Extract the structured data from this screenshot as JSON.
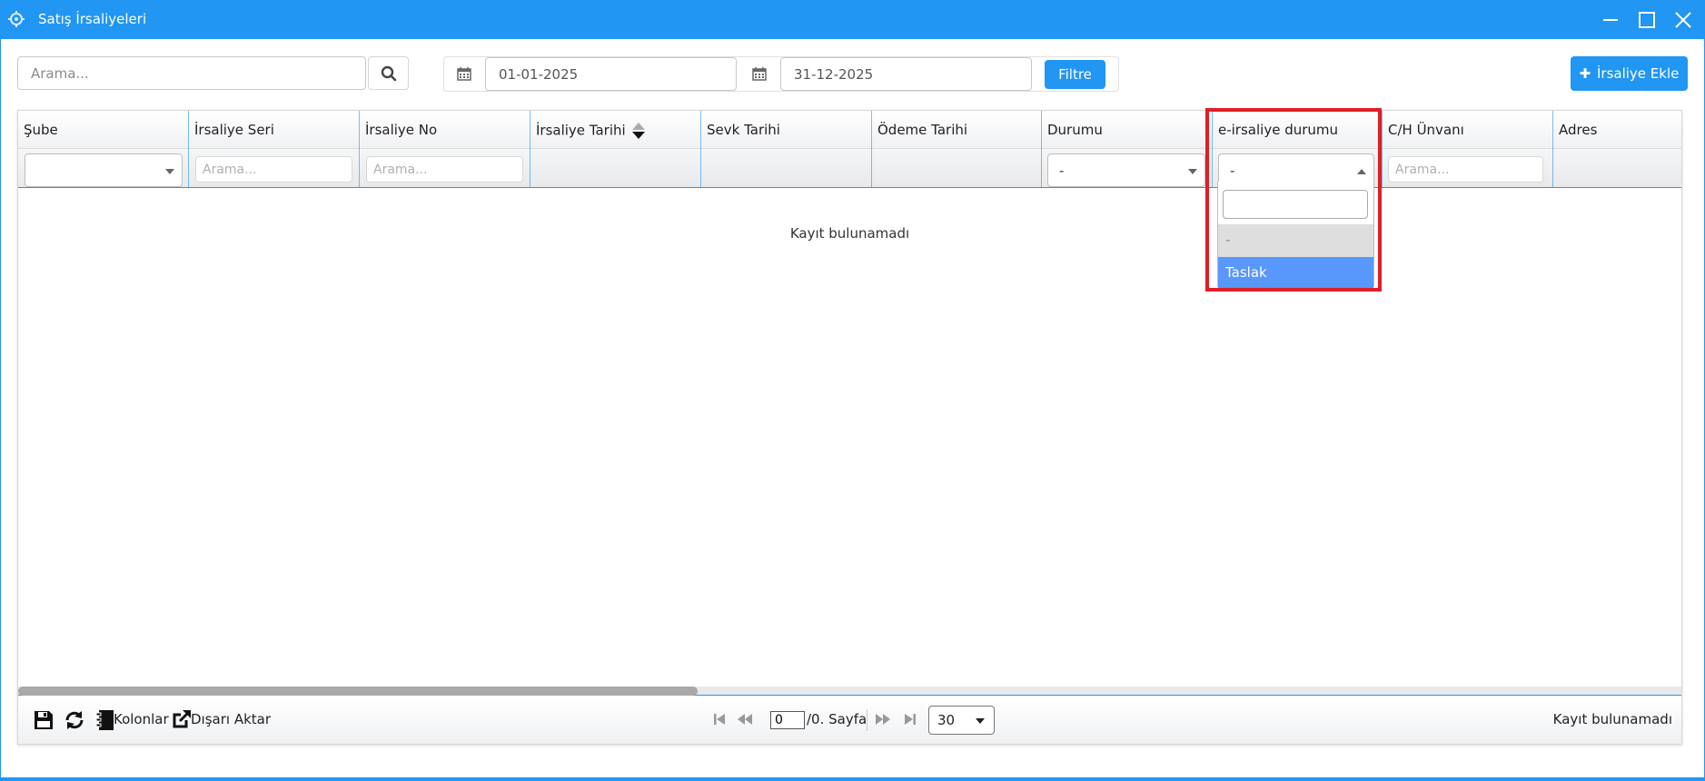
{
  "window": {
    "title": "Satış İrsaliyeleri",
    "title_icon": "gear-icon",
    "controls": [
      "minimize-icon",
      "maximize-icon",
      "close-icon"
    ]
  },
  "toolbar": {
    "search_placeholder": "Arama...",
    "start_date": "01-01-2025",
    "end_date": "31-12-2025",
    "filter_label": "Filtre",
    "add_label": "İrsaliye Ekle"
  },
  "grid": {
    "columns": [
      "Şube",
      "İrsaliye Seri",
      "İrsaliye No",
      "İrsaliye Tarihi",
      "Sevk Tarihi",
      "Ödeme Tarihi",
      "Durumu",
      "e-irsaliye durumu",
      "C/H Ünvanı",
      "Adres"
    ],
    "filter_placeholder": "Arama...",
    "durumu_value": "-",
    "e_irsaliye_value": "-",
    "empty_message": "Kayıt bulunamadı",
    "dropdown": {
      "options": [
        "-",
        "Taslak"
      ],
      "hovered": "Taslak"
    }
  },
  "footer": {
    "columns_label": "Kolonlar",
    "export_label": "Dışarı Aktar",
    "page_value": "0",
    "page_text": "/0. Sayfa",
    "page_size": "30",
    "status": "Kayıt bulunamadı"
  },
  "colors": {
    "accent": "#2196f3",
    "highlight": "#e01e26",
    "option_hover": "#5897fb"
  }
}
